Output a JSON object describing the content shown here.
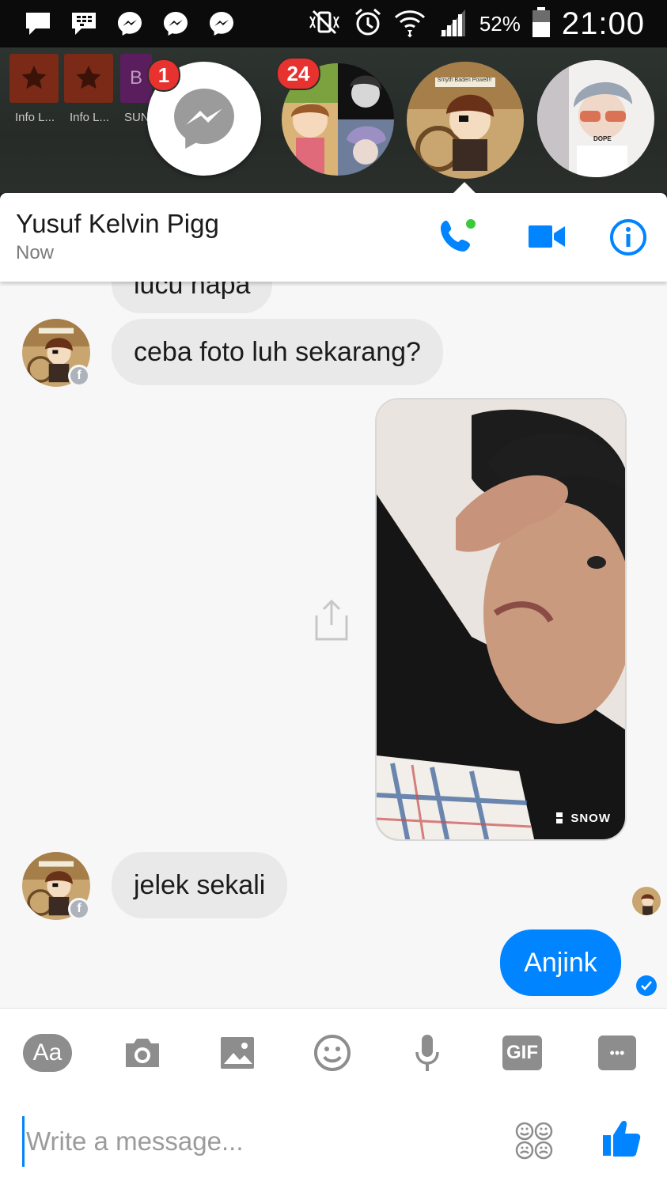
{
  "status_bar": {
    "battery_percent": "52%",
    "time": "21:00",
    "icons": [
      "chat-bubble-icon",
      "blackberry-icon",
      "messenger-icon",
      "messenger-icon",
      "messenger-icon",
      "mute-vibrate-icon",
      "alarm-icon",
      "wifi-icon",
      "signal-icon",
      "battery-icon"
    ]
  },
  "launcher": {
    "apps": [
      {
        "label": "Info L..."
      },
      {
        "label": "Info L..."
      },
      {
        "label": "SUN"
      }
    ],
    "partial_letter": "B"
  },
  "chat_heads": {
    "messenger_badge": "1",
    "group_badge": "24",
    "active_avatar_caption": "Smyth Baden Powell!!",
    "shirt_text": "DOPE"
  },
  "header": {
    "contact_name": "Yusuf Kelvin Pigg",
    "status": "Now"
  },
  "messages": [
    {
      "from": "them",
      "text": "lucu napa"
    },
    {
      "from": "them",
      "text": "ceba foto luh sekarang?"
    },
    {
      "from": "me",
      "type": "photo",
      "watermark": "SNOW"
    },
    {
      "from": "them",
      "text": "jelek sekali"
    },
    {
      "from": "me",
      "text": "Anjink"
    }
  ],
  "avatar_caption": "Smyth Baden Powell!!",
  "composer": {
    "placeholder": "Write a message...",
    "text_button": "Aa",
    "gif_button": "GIF",
    "more_button": "•••"
  },
  "colors": {
    "accent": "#0084ff",
    "incoming_bubble": "#e9e9e9",
    "badge": "#e8322f",
    "online": "#3ac93a"
  }
}
